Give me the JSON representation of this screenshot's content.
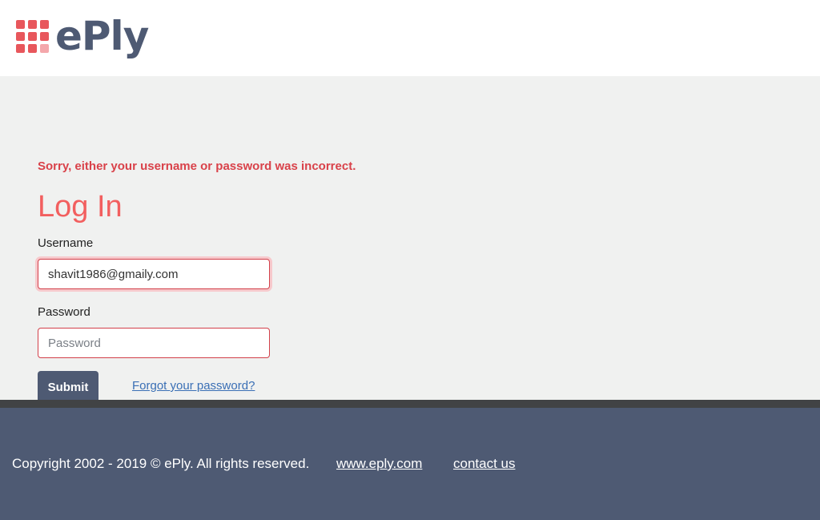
{
  "header": {
    "logo_text": "ePly"
  },
  "login": {
    "error_message": "Sorry, either your username or password was incorrect.",
    "title": "Log In",
    "username_label": "Username",
    "username_value": "shavit1986@gmaily.com",
    "password_label": "Password",
    "password_placeholder": "Password",
    "submit_label": "Submit",
    "forgot_label": "Forgot your password?"
  },
  "footer": {
    "copyright": "Copyright 2002 - 2019 © ePly. All rights reserved.",
    "site_link": "www.eply.com",
    "contact_link": "contact us"
  },
  "colors": {
    "brand_red": "#e8575c",
    "title_red": "#f25f5f",
    "error_red": "#d9424a",
    "navy": "#4e5a73",
    "link_blue": "#3a6fb5"
  }
}
